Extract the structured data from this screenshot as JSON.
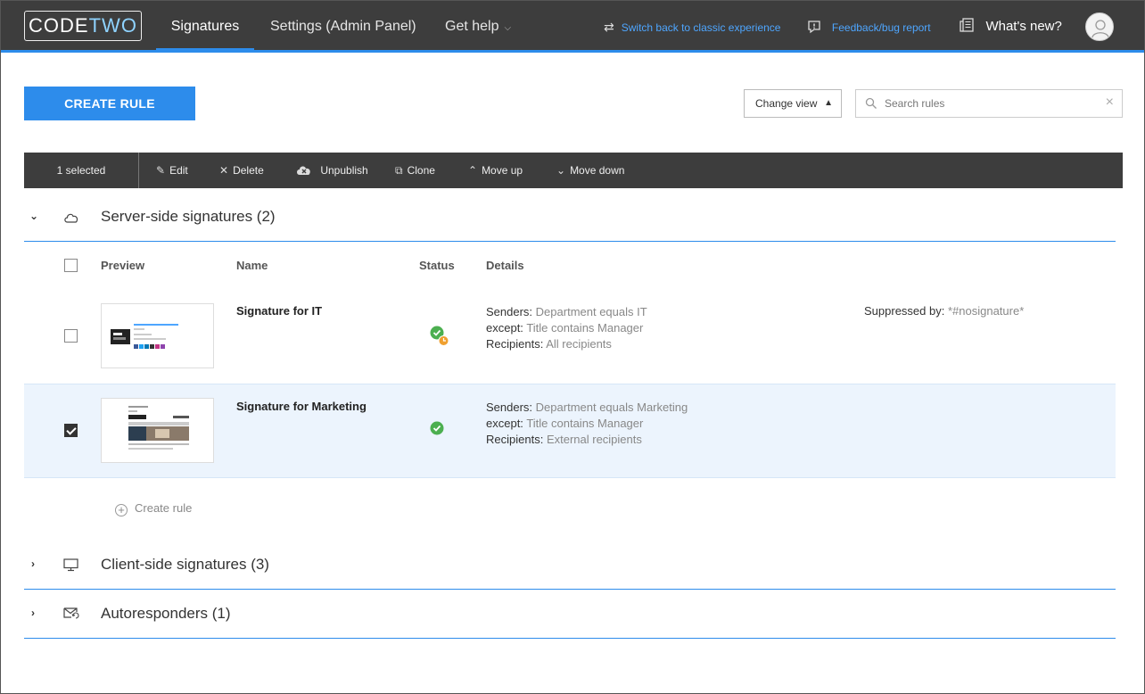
{
  "header": {
    "logo_code": "CODE",
    "logo_two": "TWO",
    "nav": [
      {
        "label": "Signatures",
        "active": true
      },
      {
        "label": "Settings (Admin Panel)"
      },
      {
        "label": "Get help"
      }
    ],
    "switch_link": "Switch back to classic experience",
    "feedback_link": "Feedback/bug report",
    "whats_new": "What's new?"
  },
  "toolbar": {
    "create_rule": "CREATE RULE",
    "change_view": "Change view",
    "search_placeholder": "Search rules"
  },
  "actionbar": {
    "selected": "1 selected",
    "edit": "Edit",
    "delete": "Delete",
    "unpublish": "Unpublish",
    "clone": "Clone",
    "move_up": "Move up",
    "move_down": "Move down"
  },
  "sections": {
    "server": {
      "title": "Server-side signatures (2)",
      "expanded": true
    },
    "client": {
      "title": "Client-side signatures (3)",
      "expanded": false
    },
    "auto": {
      "title": "Autoresponders (1)",
      "expanded": false
    }
  },
  "columns": {
    "preview": "Preview",
    "name": "Name",
    "status": "Status",
    "details": "Details"
  },
  "rules": [
    {
      "name": "Signature for IT",
      "checked": false,
      "status": "published-scheduled",
      "senders_label": "Senders:",
      "senders_value": "Department equals IT",
      "except_label": "except:",
      "except_value": "Title contains Manager",
      "recipients_label": "Recipients:",
      "recipients_value": "All recipients",
      "suppressed_label": "Suppressed by:",
      "suppressed_value": "*#nosignature*"
    },
    {
      "name": "Signature for Marketing",
      "checked": true,
      "status": "published",
      "senders_label": "Senders:",
      "senders_value": "Department equals Marketing",
      "except_label": "except:",
      "except_value": "Title contains Manager",
      "recipients_label": "Recipients:",
      "recipients_value": "External recipients"
    }
  ],
  "create_rule_link": "Create rule",
  "colors": {
    "accent": "#2d8ceb",
    "topbar": "#3d3d3d",
    "ok": "#4caf50",
    "pending": "#f0a030"
  }
}
